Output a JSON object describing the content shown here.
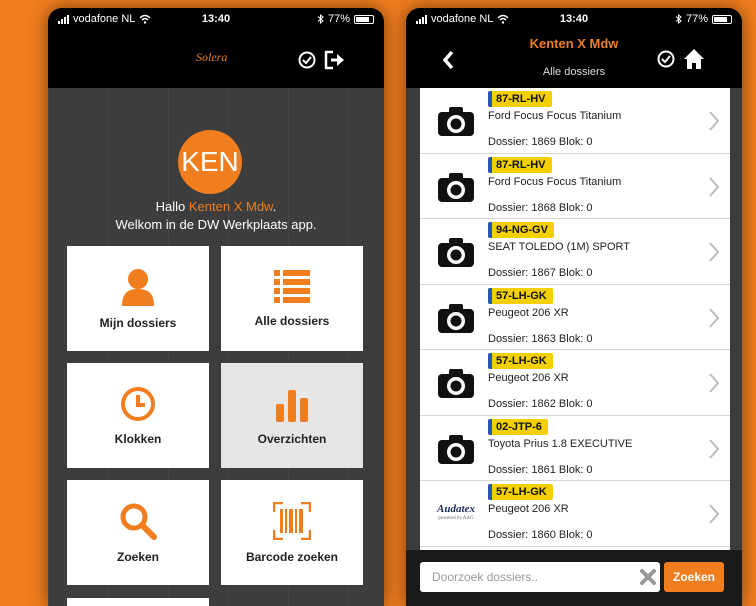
{
  "colors": {
    "accent": "#f07d1e",
    "background": "#f07d1e",
    "plate_yellow": "#f5d000"
  },
  "status_left": {
    "carrier": "vodafone NL",
    "time": "13:40",
    "battery": "77%"
  },
  "status_right": {
    "carrier": "vodafone NL",
    "time": "13:40",
    "battery": "77%"
  },
  "home": {
    "logo": "Solera",
    "avatar_initials": "KEN",
    "greeting_prefix": "Hallo ",
    "user_name": "Kenten X Mdw",
    "greeting_suffix": ".",
    "welcome": "Welkom in de DW Werkplaats app.",
    "tiles": [
      {
        "label": "Mijn dossiers",
        "icon": "person-icon"
      },
      {
        "label": "Alle dossiers",
        "icon": "list-icon"
      },
      {
        "label": "Klokken",
        "icon": "clock-icon"
      },
      {
        "label": "Overzichten",
        "icon": "bar-chart-icon"
      },
      {
        "label": "Zoeken",
        "icon": "search-icon"
      },
      {
        "label": "Barcode zoeken",
        "icon": "barcode-icon"
      }
    ]
  },
  "list_screen": {
    "title": "Kenten X Mdw",
    "subtitle": "Alle dossiers",
    "items": [
      {
        "plate": "87-RL-HV",
        "vehicle": "Ford Focus Focus Titanium",
        "dossier": "Dossier: 1869 Blok: 0",
        "thumb": "camera-icon"
      },
      {
        "plate": "87-RL-HV",
        "vehicle": "Ford Focus Focus Titanium",
        "dossier": "Dossier: 1868 Blok: 0",
        "thumb": "camera-icon"
      },
      {
        "plate": "94-NG-GV",
        "vehicle": "SEAT TOLEDO (1M) SPORT",
        "dossier": "Dossier: 1867 Blok: 0",
        "thumb": "camera-icon"
      },
      {
        "plate": "57-LH-GK",
        "vehicle": "Peugeot 206 XR",
        "dossier": "Dossier: 1863 Blok: 0",
        "thumb": "camera-icon"
      },
      {
        "plate": "57-LH-GK",
        "vehicle": "Peugeot 206 XR",
        "dossier": "Dossier: 1862 Blok: 0",
        "thumb": "camera-icon"
      },
      {
        "plate": "02-JTP-6",
        "vehicle": "Toyota Prius 1.8 EXECUTIVE",
        "dossier": "Dossier: 1861 Blok: 0",
        "thumb": "camera-icon"
      },
      {
        "plate": "57-LH-GK",
        "vehicle": "Peugeot 206 XR",
        "dossier": "Dossier: 1860 Blok: 0",
        "thumb": "audatex-logo",
        "logo_text": "Audatex",
        "logo_sub": "powered by AAG"
      }
    ],
    "search": {
      "placeholder": "Doorzoek dossiers..",
      "button": "Zoeken"
    }
  }
}
